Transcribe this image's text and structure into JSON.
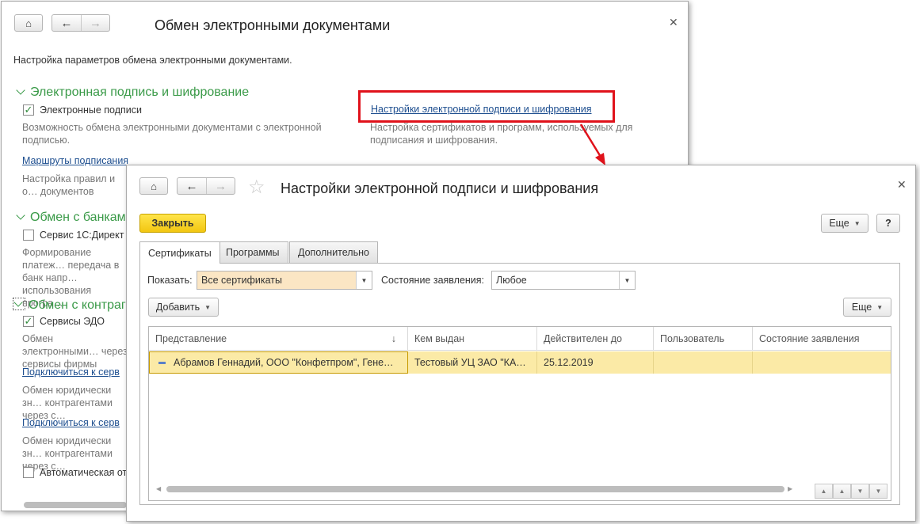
{
  "back_window": {
    "title": "Обмен электронными документами",
    "intro": "Настройка параметров обмена электронными документами.",
    "section1": {
      "title": "Электронная подпись и шифрование",
      "checkbox_label": "Электронные подписи",
      "checkbox_checked": true,
      "checkbox_desc": "Возможность обмена электронными документами с электронной подписью.",
      "link_routes": "Маршруты подписания",
      "routes_desc": "Настройка правил и о… документов",
      "settings_link": "Настройки электронной подписи и шифрования",
      "settings_desc": "Настройка сертификатов и программ, используемых для подписания и шифрования."
    },
    "section2": {
      "title": "Обмен с банками",
      "checkbox_label": "Сервис 1С:Директ",
      "desc": "Формирование платеж… передача в банк напр… использования програ…"
    },
    "section3": {
      "title": "Обмен с контраг",
      "checkbox_label": "Сервисы ЭДО",
      "desc": "Обмен электронными… через сервисы фирмы",
      "link1": "Подключиться к серв",
      "link1_desc": "Обмен юридически зн… контрагентами через с…",
      "link2": "Подключиться к серв",
      "link2_desc": "Обмен юридически зн… контрагентами через с…",
      "auto_label": "Автоматическая от"
    }
  },
  "front_window": {
    "title": "Настройки электронной подписи и шифрования",
    "close_button": "Закрыть",
    "more_button": "Еще",
    "help_button": "?",
    "tabs": [
      "Сертификаты",
      "Программы",
      "Дополнительно"
    ],
    "show_label": "Показать:",
    "show_value": "Все сертификаты",
    "state_label": "Состояние заявления:",
    "state_value": "Любое",
    "add_button": "Добавить",
    "grid_more_button": "Еще",
    "columns": [
      "Представление",
      "Кем выдан",
      "Действителен до",
      "Пользователь",
      "Состояние заявления"
    ],
    "sort_indicator": "↓",
    "rows": [
      [
        "Абрамов Геннадий, ООО \"Конфетпром\", Гене…",
        "Тестовый УЦ ЗАО \"КА…",
        "25.12.2019",
        "",
        ""
      ]
    ]
  },
  "colors": {
    "section_green": "#3a9a48",
    "highlight_red": "#e0121b",
    "selected_row": "#fbeaa6",
    "primary_button": "#f2c611"
  }
}
